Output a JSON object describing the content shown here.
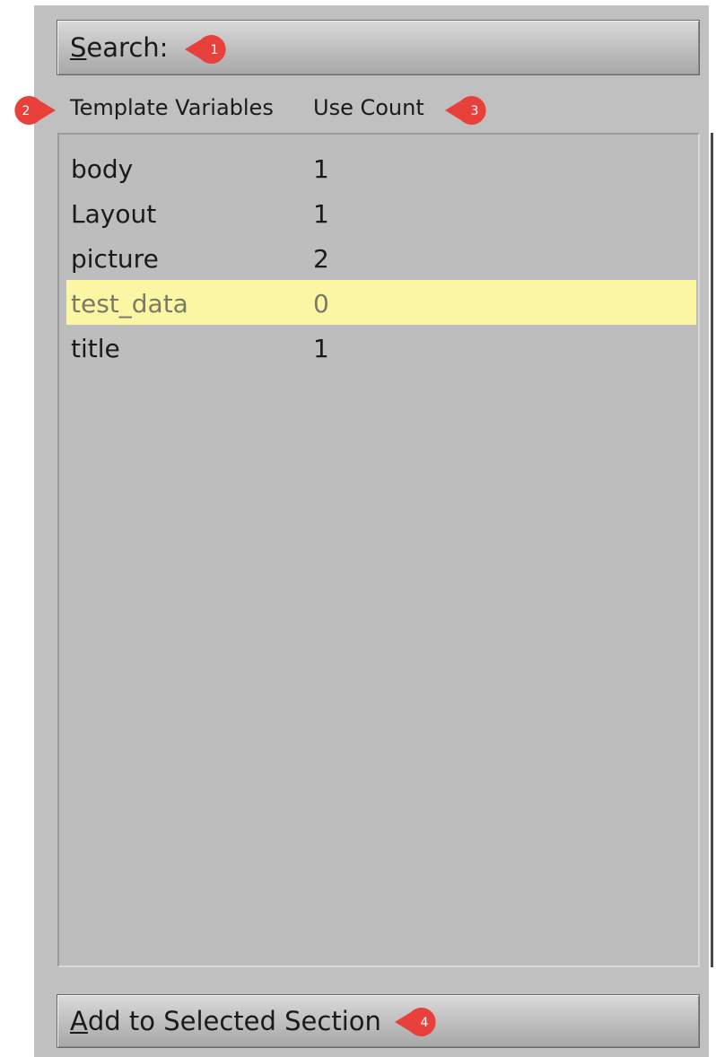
{
  "search": {
    "mnemonic": "S",
    "rest": "earch:"
  },
  "columns": {
    "name_header": "Template Variables",
    "count_header": "Use Count"
  },
  "variables": [
    {
      "name": "body",
      "count": "1"
    },
    {
      "name": "Layout",
      "count": "1"
    },
    {
      "name": "picture",
      "count": "2"
    },
    {
      "name": "test_data",
      "count": "0",
      "selected": true
    },
    {
      "name": "title",
      "count": "1"
    }
  ],
  "add_button": {
    "mnemonic": "A",
    "rest": "dd to Selected Section"
  },
  "callouts": [
    "1",
    "2",
    "3",
    "4"
  ],
  "colors": {
    "panel": "#c0c0c0",
    "selection": "#fbf6a3",
    "callout": "#e8403a"
  }
}
